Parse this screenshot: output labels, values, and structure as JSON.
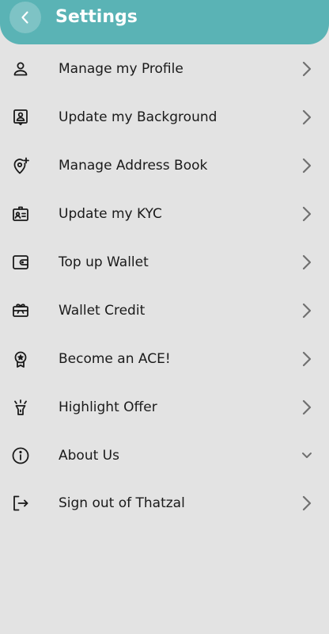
{
  "header": {
    "title": "Settings",
    "back_icon": "chevron-left-icon",
    "background_color": "#5ab3b5"
  },
  "menu": {
    "items": [
      {
        "label": "Manage my Profile",
        "icon": "user-icon",
        "trailing": "chevron-right-icon"
      },
      {
        "label": "Update my Background",
        "icon": "portrait-frame-icon",
        "trailing": "chevron-right-icon"
      },
      {
        "label": "Manage Address Book",
        "icon": "location-pin-add-icon",
        "trailing": "chevron-right-icon"
      },
      {
        "label": "Update my KYC",
        "icon": "id-card-icon",
        "trailing": "chevron-right-icon"
      },
      {
        "label": "Top up Wallet",
        "icon": "wallet-icon",
        "trailing": "chevron-right-icon"
      },
      {
        "label": "Wallet Credit",
        "icon": "gift-card-icon",
        "trailing": "chevron-right-icon"
      },
      {
        "label": "Become an ACE!",
        "icon": "award-star-icon",
        "trailing": "chevron-right-icon"
      },
      {
        "label": "Highlight Offer",
        "icon": "flashlight-icon",
        "trailing": "chevron-right-icon"
      },
      {
        "label": "About Us",
        "icon": "info-circle-icon",
        "trailing": "chevron-down-icon"
      },
      {
        "label": "Sign out of Thatzal",
        "icon": "sign-out-icon",
        "trailing": "chevron-right-icon"
      }
    ]
  }
}
